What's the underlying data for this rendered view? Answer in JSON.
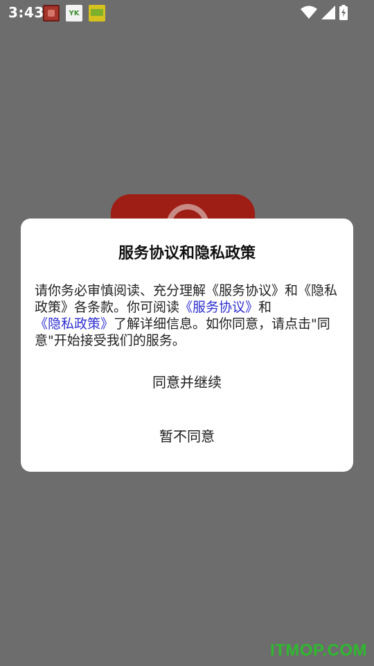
{
  "status_bar": {
    "time": "3:43",
    "notification_icons": [
      "app-notification-icon",
      "yk-app-icon",
      "green-app-icon"
    ],
    "notif_2_text": "YK",
    "system_icons": [
      "wifi-icon",
      "cellular-signal-icon",
      "battery-charging-icon"
    ]
  },
  "dialog": {
    "title": "服务协议和隐私政策",
    "body": {
      "part1": "请你务必审慎阅读、充分理解《服务协议》和《隐私政策》各条款。你可阅读",
      "link_service": "《服务协议》",
      "part2": "和",
      "link_privacy": "《隐私政策》",
      "part3": "了解详细信息。如你同意，请点击\"同意\"开始接受我们的服务。"
    },
    "agree_label": "同意并继续",
    "decline_label": "暂不同意"
  },
  "watermark": "ITMOP.COM",
  "colors": {
    "overlay": "#6d6d6d",
    "link": "#2f2fd0",
    "watermark": "#2fb82f"
  }
}
